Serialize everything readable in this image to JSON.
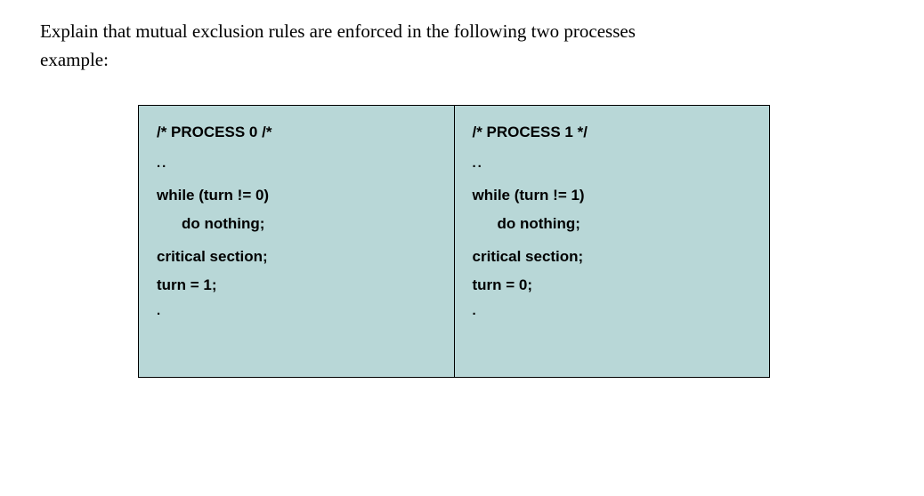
{
  "question": {
    "line1": "Explain that mutual exclusion rules are enforced in the following two processes",
    "line2": "example:"
  },
  "table": {
    "proc0": {
      "header": "/* PROCESS 0 /*",
      "dots": "..",
      "whileLine": "while (turn != 0)",
      "doLine": "do nothing;",
      "crit": "critical section;",
      "assign": "turn = 1;",
      "trail": "."
    },
    "proc1": {
      "header": "/* PROCESS 1 */",
      "dots": "..",
      "whileLine": "while (turn != 1)",
      "doLine": "do nothing;",
      "crit": "critical section;",
      "assign": "turn = 0;",
      "trail": "."
    }
  }
}
